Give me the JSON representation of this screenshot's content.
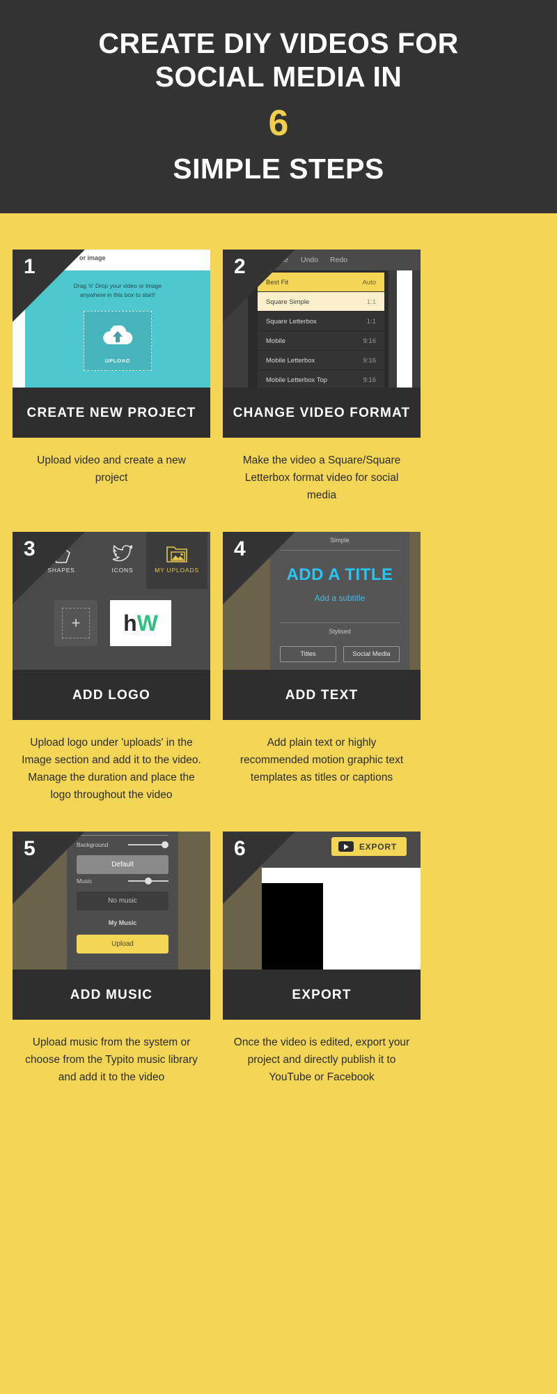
{
  "header": {
    "line1": "CREATE DIY VIDEOS FOR",
    "line2": "SOCIAL MEDIA IN",
    "number": "6",
    "line3": "SIMPLE STEPS",
    "bg_color": "#333333",
    "accent_color": "#f0cf4e"
  },
  "theme": {
    "page_bg": "#f3d655",
    "dark": "#2e2e2e",
    "accent": "#f3d655",
    "teal": "#4ec8cf",
    "cyan_text": "#29c5f6"
  },
  "steps": [
    {
      "number": "1",
      "title": "CREATE NEW PROJECT",
      "caption": "Upload video and create a new project",
      "shot": {
        "topbar_text": "or image",
        "hint_line1": "Drag 'n' Drop your video or image",
        "hint_line2": "anywhere in this box to start!",
        "upload_label": "UPLOAD"
      }
    },
    {
      "number": "2",
      "title": "CHANGE VIDEO FORMAT",
      "caption": "Make the video a Square/Square Letterbox format video for social media",
      "shot": {
        "menu": [
          "Resize",
          "Undo",
          "Redo"
        ],
        "options": [
          {
            "name": "Best Fit",
            "ratio": "Auto",
            "state": "selected"
          },
          {
            "name": "Square Simple",
            "ratio": "1:1",
            "state": "hover"
          },
          {
            "name": "Square Letterbox",
            "ratio": "1:1",
            "state": "normal"
          },
          {
            "name": "Mobile",
            "ratio": "9:16",
            "state": "normal"
          },
          {
            "name": "Mobile Letterbox",
            "ratio": "9:16",
            "state": "normal"
          },
          {
            "name": "Mobile Letterbox Top",
            "ratio": "9:16",
            "state": "normal"
          }
        ]
      }
    },
    {
      "number": "3",
      "title": "ADD LOGO",
      "caption": "Upload logo under 'uploads' in the Image section and add it to the video. Manage the duration and place the logo throughout the video",
      "shot": {
        "tabs": [
          "SHAPES",
          "ICONS",
          "MY UPLOADS"
        ],
        "active_tab": "MY UPLOADS",
        "add_button": "+",
        "logo_text_dark": "h",
        "logo_text_green": "W"
      }
    },
    {
      "number": "4",
      "title": "ADD TEXT",
      "caption": "Add plain text or highly recommended motion graphic text templates as titles or captions",
      "shot": {
        "section1": "Simple",
        "title_text": "ADD A TITLE",
        "subtitle_text": "Add a subtitle",
        "section2": "Stylised",
        "buttons": [
          "Titles",
          "Social Media"
        ]
      }
    },
    {
      "number": "5",
      "title": "ADD MUSIC",
      "caption": "Upload music from the system or choose from the Typito music library and add it to the video",
      "shot": {
        "background_label": "Background",
        "background_button": "Default",
        "music_label": "Music",
        "music_button": "No music",
        "my_music_label": "My Music",
        "upload_button": "Upload"
      }
    },
    {
      "number": "6",
      "title": "EXPORT",
      "caption": "Once the video is edited, export your project and directly publish it to YouTube or Facebook",
      "shot": {
        "export_button": "EXPORT"
      }
    }
  ]
}
